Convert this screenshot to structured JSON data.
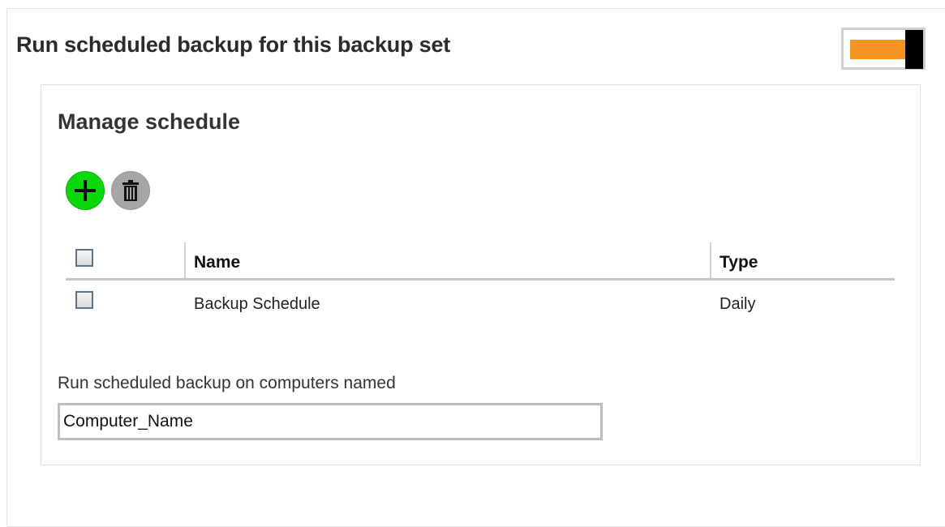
{
  "section": {
    "title": "Run scheduled backup for this backup set",
    "toggle": {
      "state": "on",
      "accent_color": "#f29322"
    }
  },
  "manage": {
    "title": "Manage schedule",
    "actions": [
      {
        "name": "add",
        "icon": "plus-icon",
        "color": "#0ad80a"
      },
      {
        "name": "delete",
        "icon": "trash-icon",
        "color": "#a6a6a6"
      }
    ],
    "table": {
      "columns": [
        "Name",
        "Type"
      ],
      "rows": [
        {
          "checked": false,
          "name": "Backup Schedule",
          "type": "Daily"
        }
      ]
    }
  },
  "computers": {
    "label": "Run scheduled backup on computers named",
    "value": "Computer_Name"
  }
}
